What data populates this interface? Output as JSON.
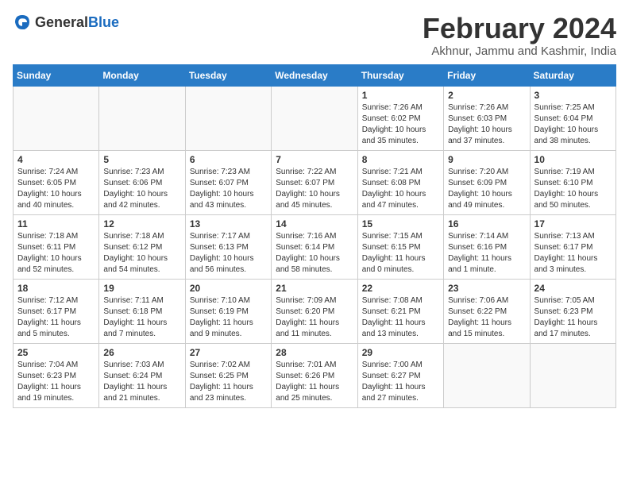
{
  "header": {
    "logo_general": "General",
    "logo_blue": "Blue",
    "title": "February 2024",
    "subtitle": "Akhnur, Jammu and Kashmir, India"
  },
  "days_of_week": [
    "Sunday",
    "Monday",
    "Tuesday",
    "Wednesday",
    "Thursday",
    "Friday",
    "Saturday"
  ],
  "weeks": [
    [
      {
        "day": "",
        "content": ""
      },
      {
        "day": "",
        "content": ""
      },
      {
        "day": "",
        "content": ""
      },
      {
        "day": "",
        "content": ""
      },
      {
        "day": "1",
        "content": "Sunrise: 7:26 AM\nSunset: 6:02 PM\nDaylight: 10 hours\nand 35 minutes."
      },
      {
        "day": "2",
        "content": "Sunrise: 7:26 AM\nSunset: 6:03 PM\nDaylight: 10 hours\nand 37 minutes."
      },
      {
        "day": "3",
        "content": "Sunrise: 7:25 AM\nSunset: 6:04 PM\nDaylight: 10 hours\nand 38 minutes."
      }
    ],
    [
      {
        "day": "4",
        "content": "Sunrise: 7:24 AM\nSunset: 6:05 PM\nDaylight: 10 hours\nand 40 minutes."
      },
      {
        "day": "5",
        "content": "Sunrise: 7:23 AM\nSunset: 6:06 PM\nDaylight: 10 hours\nand 42 minutes."
      },
      {
        "day": "6",
        "content": "Sunrise: 7:23 AM\nSunset: 6:07 PM\nDaylight: 10 hours\nand 43 minutes."
      },
      {
        "day": "7",
        "content": "Sunrise: 7:22 AM\nSunset: 6:07 PM\nDaylight: 10 hours\nand 45 minutes."
      },
      {
        "day": "8",
        "content": "Sunrise: 7:21 AM\nSunset: 6:08 PM\nDaylight: 10 hours\nand 47 minutes."
      },
      {
        "day": "9",
        "content": "Sunrise: 7:20 AM\nSunset: 6:09 PM\nDaylight: 10 hours\nand 49 minutes."
      },
      {
        "day": "10",
        "content": "Sunrise: 7:19 AM\nSunset: 6:10 PM\nDaylight: 10 hours\nand 50 minutes."
      }
    ],
    [
      {
        "day": "11",
        "content": "Sunrise: 7:18 AM\nSunset: 6:11 PM\nDaylight: 10 hours\nand 52 minutes."
      },
      {
        "day": "12",
        "content": "Sunrise: 7:18 AM\nSunset: 6:12 PM\nDaylight: 10 hours\nand 54 minutes."
      },
      {
        "day": "13",
        "content": "Sunrise: 7:17 AM\nSunset: 6:13 PM\nDaylight: 10 hours\nand 56 minutes."
      },
      {
        "day": "14",
        "content": "Sunrise: 7:16 AM\nSunset: 6:14 PM\nDaylight: 10 hours\nand 58 minutes."
      },
      {
        "day": "15",
        "content": "Sunrise: 7:15 AM\nSunset: 6:15 PM\nDaylight: 11 hours\nand 0 minutes."
      },
      {
        "day": "16",
        "content": "Sunrise: 7:14 AM\nSunset: 6:16 PM\nDaylight: 11 hours\nand 1 minute."
      },
      {
        "day": "17",
        "content": "Sunrise: 7:13 AM\nSunset: 6:17 PM\nDaylight: 11 hours\nand 3 minutes."
      }
    ],
    [
      {
        "day": "18",
        "content": "Sunrise: 7:12 AM\nSunset: 6:17 PM\nDaylight: 11 hours\nand 5 minutes."
      },
      {
        "day": "19",
        "content": "Sunrise: 7:11 AM\nSunset: 6:18 PM\nDaylight: 11 hours\nand 7 minutes."
      },
      {
        "day": "20",
        "content": "Sunrise: 7:10 AM\nSunset: 6:19 PM\nDaylight: 11 hours\nand 9 minutes."
      },
      {
        "day": "21",
        "content": "Sunrise: 7:09 AM\nSunset: 6:20 PM\nDaylight: 11 hours\nand 11 minutes."
      },
      {
        "day": "22",
        "content": "Sunrise: 7:08 AM\nSunset: 6:21 PM\nDaylight: 11 hours\nand 13 minutes."
      },
      {
        "day": "23",
        "content": "Sunrise: 7:06 AM\nSunset: 6:22 PM\nDaylight: 11 hours\nand 15 minutes."
      },
      {
        "day": "24",
        "content": "Sunrise: 7:05 AM\nSunset: 6:23 PM\nDaylight: 11 hours\nand 17 minutes."
      }
    ],
    [
      {
        "day": "25",
        "content": "Sunrise: 7:04 AM\nSunset: 6:23 PM\nDaylight: 11 hours\nand 19 minutes."
      },
      {
        "day": "26",
        "content": "Sunrise: 7:03 AM\nSunset: 6:24 PM\nDaylight: 11 hours\nand 21 minutes."
      },
      {
        "day": "27",
        "content": "Sunrise: 7:02 AM\nSunset: 6:25 PM\nDaylight: 11 hours\nand 23 minutes."
      },
      {
        "day": "28",
        "content": "Sunrise: 7:01 AM\nSunset: 6:26 PM\nDaylight: 11 hours\nand 25 minutes."
      },
      {
        "day": "29",
        "content": "Sunrise: 7:00 AM\nSunset: 6:27 PM\nDaylight: 11 hours\nand 27 minutes."
      },
      {
        "day": "",
        "content": ""
      },
      {
        "day": "",
        "content": ""
      }
    ]
  ]
}
